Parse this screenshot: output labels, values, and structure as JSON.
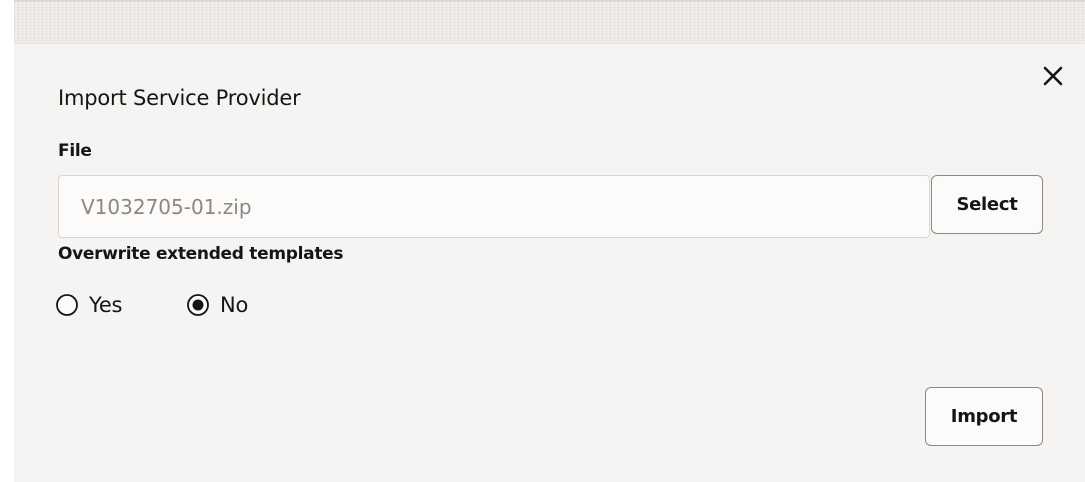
{
  "dialog": {
    "title": "Import Service Provider",
    "close_icon": "close-icon",
    "file_label": "File",
    "file_input": {
      "value": "V1032705-01.zip",
      "placeholder": "V1032705-01.zip"
    },
    "select_button_label": "Select",
    "overwrite_label": "Overwrite extended templates",
    "overwrite_options": [
      {
        "label": "Yes",
        "selected": false
      },
      {
        "label": "No",
        "selected": true
      }
    ],
    "import_button_label": "Import"
  },
  "colors": {
    "text": "#161513",
    "muted_text": "#8a8784",
    "dialog_background": "#f5f4f2",
    "border": "#8c8985"
  }
}
